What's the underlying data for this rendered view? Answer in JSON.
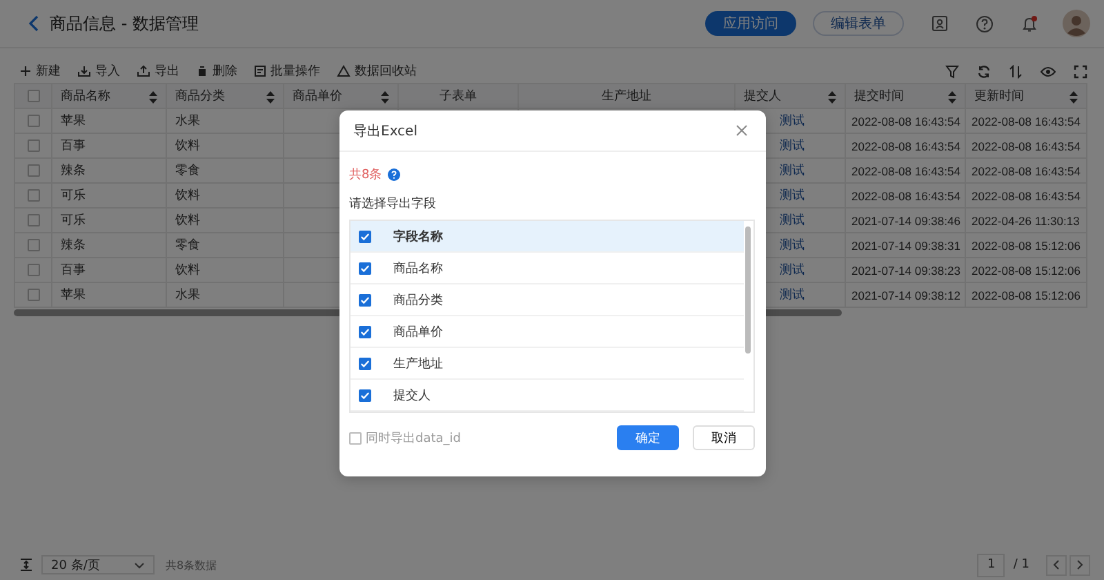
{
  "header": {
    "title": "商品信息 - 数据管理",
    "buttons": [
      {
        "label": "应用访问",
        "kind": "primary"
      },
      {
        "label": "编辑表单",
        "kind": "outline"
      }
    ]
  },
  "toolbar": {
    "actions": [
      {
        "label": "新建"
      },
      {
        "label": "导入"
      },
      {
        "label": "导出"
      },
      {
        "label": "删除"
      },
      {
        "label": "批量操作"
      },
      {
        "label": "数据回收站"
      }
    ]
  },
  "table": {
    "all_checked": false,
    "columns": [
      {
        "label": "商品名称",
        "sortable": true
      },
      {
        "label": "商品分类",
        "sortable": true
      },
      {
        "label": "商品单价",
        "sortable": true
      },
      {
        "label": "子表单",
        "sortable": false
      },
      {
        "label": "生产地址",
        "sortable": false
      },
      {
        "label": "提交人",
        "sortable": true
      },
      {
        "label": "提交时间",
        "sortable": true
      },
      {
        "label": "更新时间",
        "sortable": true
      }
    ],
    "rows": [
      {
        "checked": false,
        "name": "苹果",
        "category": "水果",
        "submitter": "测试",
        "submitted": "2022-08-08 16:43:54",
        "updated": "2022-08-08 16:43:54"
      },
      {
        "checked": false,
        "name": "百事",
        "category": "饮料",
        "submitter": "测试",
        "submitted": "2022-08-08 16:43:54",
        "updated": "2022-08-08 16:43:54"
      },
      {
        "checked": false,
        "name": "辣条",
        "category": "零食",
        "submitter": "测试",
        "submitted": "2022-08-08 16:43:54",
        "updated": "2022-08-08 16:43:54"
      },
      {
        "checked": false,
        "name": "可乐",
        "category": "饮料",
        "submitter": "测试",
        "submitted": "2022-08-08 16:43:54",
        "updated": "2022-08-08 16:43:54"
      },
      {
        "checked": false,
        "name": "可乐",
        "category": "饮料",
        "submitter": "测试",
        "submitted": "2021-07-14 09:38:46",
        "updated": "2022-04-26 11:30:13"
      },
      {
        "checked": false,
        "name": "辣条",
        "category": "零食",
        "submitter": "测试",
        "submitted": "2021-07-14 09:38:31",
        "updated": "2022-08-08 15:12:06"
      },
      {
        "checked": false,
        "name": "百事",
        "category": "饮料",
        "submitter": "测试",
        "submitted": "2021-07-14 09:38:23",
        "updated": "2022-08-08 15:12:06"
      },
      {
        "checked": false,
        "name": "苹果",
        "category": "水果",
        "submitter": "测试",
        "submitted": "2021-07-14 09:38:12",
        "updated": "2022-08-08 15:12:06"
      }
    ]
  },
  "pagination": {
    "page_size": "20 条/页",
    "total": "共8条数据",
    "page": "1",
    "pages": "/ 1"
  },
  "dialog": {
    "title": "导出Excel",
    "count": "共8条",
    "prompt": "请选择导出字段",
    "fields": [
      {
        "label": "字段名称",
        "kind": "header",
        "checked": true
      },
      {
        "label": "商品名称",
        "kind": "field",
        "checked": true
      },
      {
        "label": "商品分类",
        "kind": "field",
        "checked": true
      },
      {
        "label": "商品单价",
        "kind": "field",
        "checked": true
      },
      {
        "label": "生产地址",
        "kind": "field",
        "checked": true
      },
      {
        "label": "提交人",
        "kind": "field",
        "checked": true
      }
    ],
    "export_id": {
      "label": "同时导出data_id",
      "checked": false
    },
    "buttons": [
      {
        "label": "确定",
        "kind": "primary"
      },
      {
        "label": "取消",
        "kind": "default"
      }
    ]
  }
}
